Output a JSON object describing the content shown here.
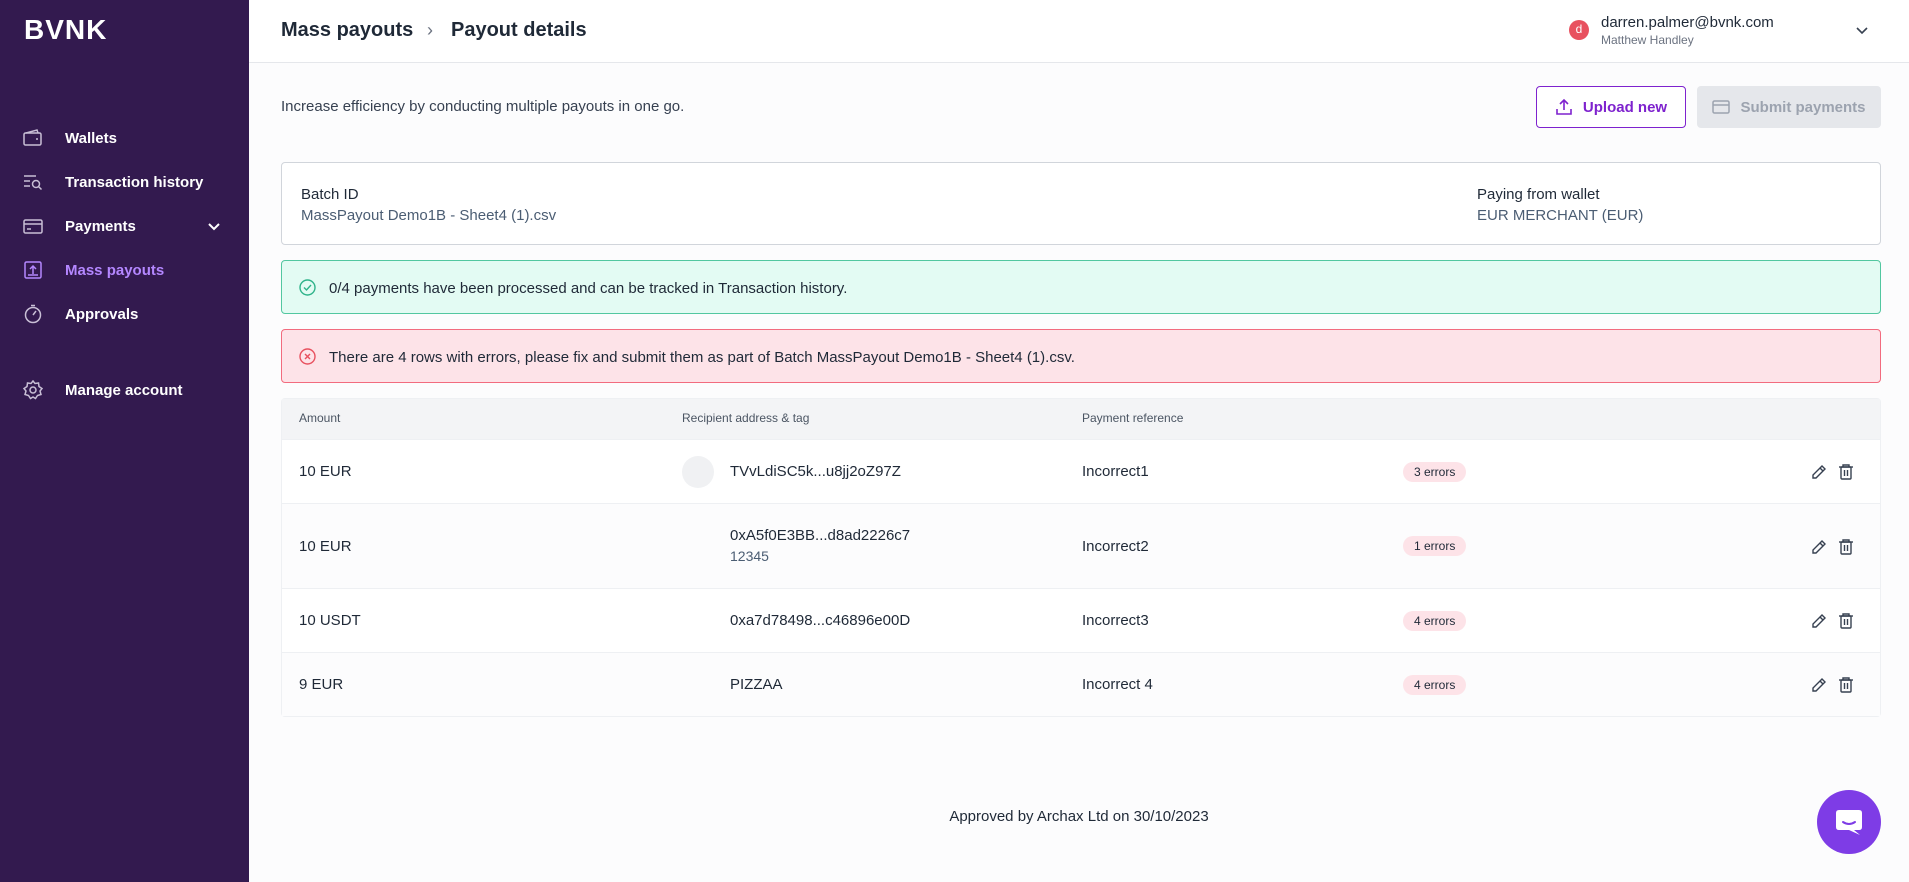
{
  "brand": {
    "logo": "BVNK"
  },
  "sidebar": {
    "items": [
      {
        "label": "Wallets",
        "icon": "wallet-icon"
      },
      {
        "label": "Transaction history",
        "icon": "search-list-icon"
      },
      {
        "label": "Payments",
        "icon": "card-icon"
      },
      {
        "label": "Mass payouts",
        "icon": "upload-box-icon",
        "active": true
      },
      {
        "label": "Approvals",
        "icon": "stopwatch-icon"
      },
      {
        "label": "Manage account",
        "icon": "gear-icon"
      }
    ]
  },
  "header": {
    "breadcrumb": [
      "Mass payouts",
      "Payout details"
    ],
    "separator": "›",
    "user": {
      "initial": "d",
      "email": "darren.palmer@bvnk.com",
      "name": "Matthew Handley"
    }
  },
  "main": {
    "intro": "Increase efficiency by conducting multiple payouts in one go.",
    "upload_label": "Upload new",
    "submit_label": "Submit payments",
    "batch": {
      "id_label": "Batch ID",
      "id_value": "MassPayout Demo1B - Sheet4 (1).csv",
      "wallet_label": "Paying from wallet",
      "wallet_value": "EUR MERCHANT (EUR)"
    },
    "success_message": "0/4 payments have been processed and can be tracked in Transaction history.",
    "error_message": "There are 4 rows with errors, please fix and submit them as part of Batch MassPayout Demo1B - Sheet4 (1).csv.",
    "table": {
      "headers": [
        "Amount",
        "Recipient address & tag",
        "Payment reference"
      ],
      "rows": [
        {
          "amount": "10 EUR",
          "address": "TVvLdiSC5k...u8jj2oZ97Z",
          "tag": "",
          "reference": "Incorrect1",
          "errors": "3 errors"
        },
        {
          "amount": "10 EUR",
          "address": "0xA5f0E3BB...d8ad2226c7",
          "tag": "12345",
          "reference": "Incorrect2",
          "errors": "1 errors"
        },
        {
          "amount": "10 USDT",
          "address": "0xa7d78498...c46896e00D",
          "tag": "",
          "reference": "Incorrect3",
          "errors": "4 errors"
        },
        {
          "amount": "9 EUR",
          "address": "PIZZAA",
          "tag": "",
          "reference": "Incorrect 4",
          "errors": "4 errors"
        }
      ]
    },
    "footer_note": "Approved by Archax Ltd on 30/10/2023"
  },
  "colors": {
    "sidebar_bg": "#331a4f",
    "accent": "#7e22ce",
    "active_nav": "#b487ff",
    "success_bg": "#e3fbf3",
    "error_bg": "#fde3e8",
    "chat_button": "#7e3ce6"
  }
}
